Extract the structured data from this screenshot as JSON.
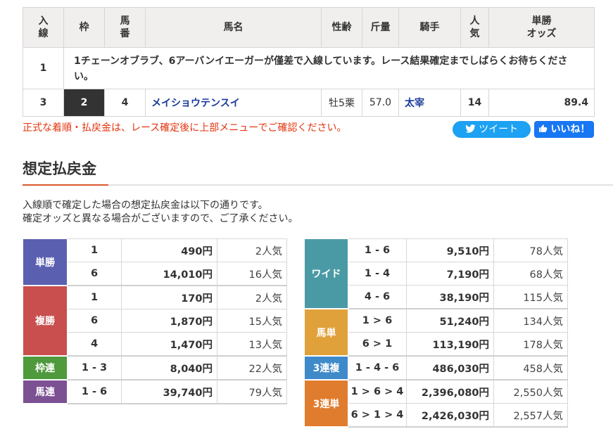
{
  "table": {
    "headers": [
      "入線",
      "枠",
      "馬番",
      "馬名",
      "性齢",
      "斤量",
      "騎手",
      "人気",
      "単勝オッズ"
    ],
    "header_lines": {
      "h0": [
        "入",
        "線"
      ],
      "h2": [
        "馬",
        "番"
      ],
      "h7": [
        "人",
        "気"
      ],
      "h8": [
        "単勝",
        "オッズ"
      ]
    },
    "notice_row": {
      "rank": "1",
      "text": "1チェーンオブラブ、6アーバンイエーガーが僅差で入線しています。レース結果確定までしばらくお待ちください。"
    },
    "row": {
      "rank": "3",
      "waku": "2",
      "umaban": "4",
      "name": "メイショウテンスイ",
      "sex_age": "牡5栗",
      "weight": "57.0",
      "jockey": "太宰",
      "popularity": "14",
      "odds": "89.4"
    }
  },
  "warning": "正式な着順・払戻金は、レース確定後に上部メニューでご確認ください。",
  "social": {
    "tweet": "ツイート",
    "like": "いいね！"
  },
  "section_title": "想定払戻金",
  "intro": {
    "line1": "入線順で確定した場合の想定払戻金は以下の通りです。",
    "line2": "確定オッズと異なる場合がございますので、ご了承ください。"
  },
  "colors": {
    "win": "#5b5fb0",
    "place": "#c94f4f",
    "bracket": "#4e9a3d",
    "quinella": "#7c5193",
    "wide": "#4a9aa5",
    "exacta": "#e1a13a",
    "trio": "#3f8ac9",
    "trifecta": "#e07c2e"
  },
  "payouts_left": [
    {
      "label": "単勝",
      "color_key": "win",
      "rows": [
        {
          "comb": "1",
          "amount": "490円",
          "pop": "2人気"
        },
        {
          "comb": "6",
          "amount": "14,010円",
          "pop": "16人気"
        }
      ]
    },
    {
      "label": "複勝",
      "color_key": "place",
      "rows": [
        {
          "comb": "1",
          "amount": "170円",
          "pop": "2人気"
        },
        {
          "comb": "6",
          "amount": "1,870円",
          "pop": "15人気"
        },
        {
          "comb": "4",
          "amount": "1,470円",
          "pop": "13人気"
        }
      ]
    },
    {
      "label": "枠連",
      "color_key": "bracket",
      "rows": [
        {
          "comb": "1 - 3",
          "amount": "8,040円",
          "pop": "22人気"
        }
      ]
    },
    {
      "label": "馬連",
      "color_key": "quinella",
      "rows": [
        {
          "comb": "1 - 6",
          "amount": "39,740円",
          "pop": "79人気"
        }
      ]
    }
  ],
  "payouts_right": [
    {
      "label": "ワイド",
      "color_key": "wide",
      "rows": [
        {
          "comb": "1 - 6",
          "amount": "9,510円",
          "pop": "78人気"
        },
        {
          "comb": "1 - 4",
          "amount": "7,190円",
          "pop": "68人気"
        },
        {
          "comb": "4 - 6",
          "amount": "38,190円",
          "pop": "115人気"
        }
      ]
    },
    {
      "label": "馬単",
      "color_key": "exacta",
      "rows": [
        {
          "comb": "1 > 6",
          "amount": "51,240円",
          "pop": "134人気"
        },
        {
          "comb": "6 > 1",
          "amount": "113,190円",
          "pop": "178人気"
        }
      ]
    },
    {
      "label": "3連複",
      "color_key": "trio",
      "rows": [
        {
          "comb": "1 - 4 - 6",
          "amount": "486,030円",
          "pop": "458人気"
        }
      ]
    },
    {
      "label": "3連単",
      "color_key": "trifecta",
      "rows": [
        {
          "comb": "1 > 6 > 4",
          "amount": "2,396,080円",
          "pop": "2,550人気"
        },
        {
          "comb": "6 > 1 > 4",
          "amount": "2,426,030円",
          "pop": "2,557人気"
        }
      ]
    }
  ]
}
